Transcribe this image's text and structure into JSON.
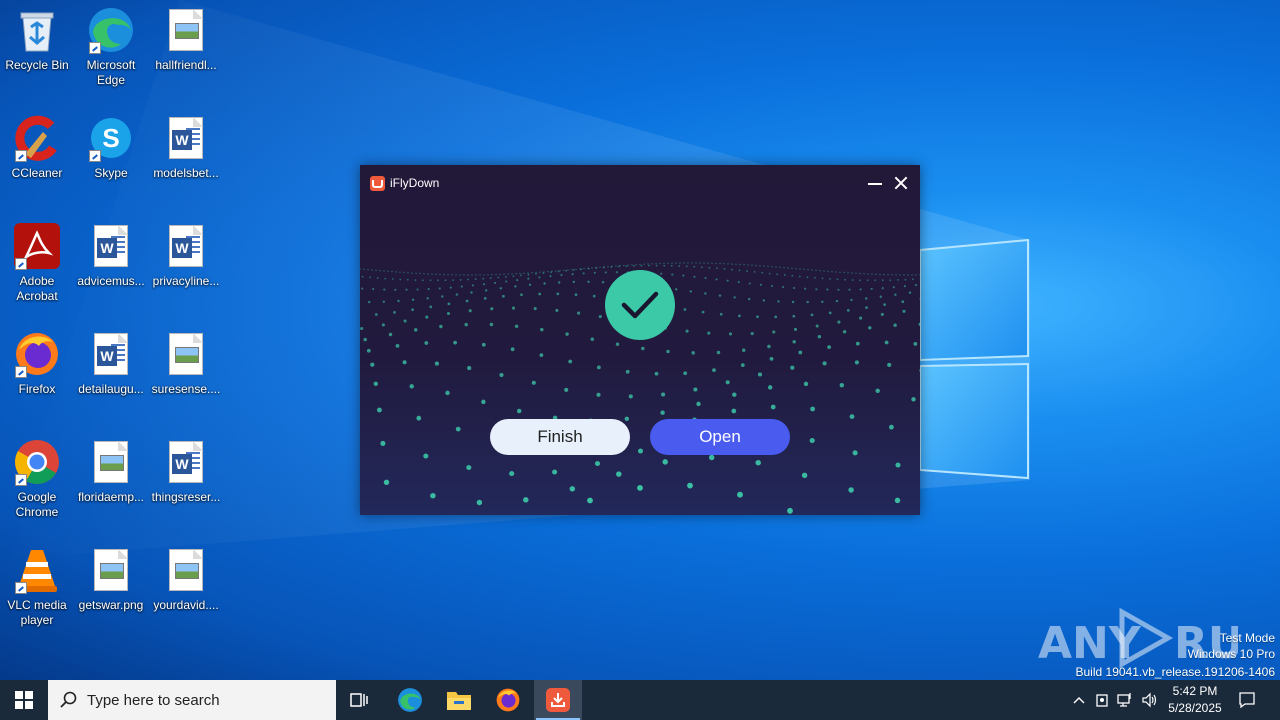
{
  "desktop": {
    "icons": [
      {
        "label": "Recycle Bin",
        "icon": "recycle-bin-icon"
      },
      {
        "label": "Microsoft Edge",
        "icon": "edge-icon"
      },
      {
        "label": "hallfriendl...",
        "icon": "image-file-icon"
      },
      {
        "label": "CCleaner",
        "icon": "ccleaner-icon"
      },
      {
        "label": "Skype",
        "icon": "skype-icon"
      },
      {
        "label": "modelsbet...",
        "icon": "word-doc-icon"
      },
      {
        "label": "Adobe Acrobat",
        "icon": "acrobat-icon"
      },
      {
        "label": "advicemus...",
        "icon": "word-doc-icon"
      },
      {
        "label": "privacyline...",
        "icon": "word-doc-icon"
      },
      {
        "label": "Firefox",
        "icon": "firefox-icon"
      },
      {
        "label": "detailaugu...",
        "icon": "word-doc-icon"
      },
      {
        "label": "suresense....",
        "icon": "image-file-icon"
      },
      {
        "label": "Google Chrome",
        "icon": "chrome-icon"
      },
      {
        "label": "floridaemp...",
        "icon": "image-file-icon"
      },
      {
        "label": "thingsreser...",
        "icon": "word-doc-icon"
      },
      {
        "label": "VLC media player",
        "icon": "vlc-icon"
      },
      {
        "label": "getswar.png",
        "icon": "image-file-icon"
      },
      {
        "label": "yourdavid....",
        "icon": "image-file-icon"
      }
    ]
  },
  "dialog": {
    "title": "iFlyDown",
    "finish_label": "Finish",
    "open_label": "Open",
    "accent": "#3cc9a8",
    "open_color": "#4a5cf0"
  },
  "watermark": {
    "brand": "ANY RUN",
    "line1": "Test Mode",
    "line2": "Windows 10 Pro",
    "line3": "Build 19041.vb_release.191206-1406"
  },
  "taskbar": {
    "search_placeholder": "Type here to search",
    "time": "5:42 PM",
    "date": "5/28/2025"
  }
}
